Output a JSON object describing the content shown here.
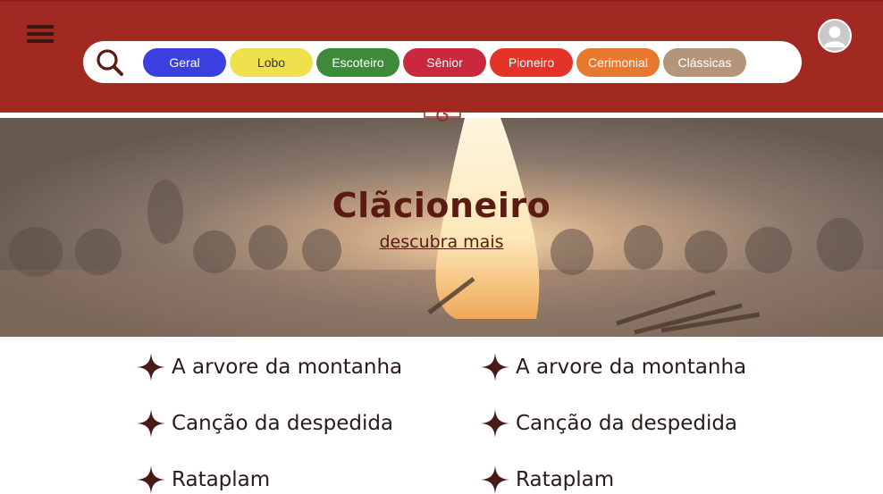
{
  "header": {
    "menu_icon": "hamburger-menu-icon",
    "avatar_icon": "user-avatar-icon",
    "search_icon": "search-icon",
    "categories": [
      {
        "label": "Geral",
        "bg": "#3b3fe0",
        "fg": "#ffffff"
      },
      {
        "label": "Lobo",
        "bg": "#efe04e",
        "fg": "#333333"
      },
      {
        "label": "Escoteiro",
        "bg": "#3f8a3a",
        "fg": "#ffffff"
      },
      {
        "label": "Sênior",
        "bg": "#c9283e",
        "fg": "#ffffff"
      },
      {
        "label": "Pioneiro",
        "bg": "#e43329",
        "fg": "#ffffff"
      },
      {
        "label": "Cerimonial",
        "bg": "#e7782f",
        "fg": "#ffffff"
      },
      {
        "label": "Clássicas",
        "bg": "#b49579",
        "fg": "#ffffff"
      }
    ]
  },
  "hero": {
    "title": "Clãcioneiro",
    "link": "descubra mais"
  },
  "songs": [
    "A arvore da montanha",
    "A arvore da montanha",
    "Canção da despedida",
    "Canção da despedida",
    "Rataplam",
    "Rataplam"
  ],
  "colors": {
    "header_bg": "#a22822",
    "accent_dark": "#5b1a12",
    "star": "#4a1a18"
  }
}
